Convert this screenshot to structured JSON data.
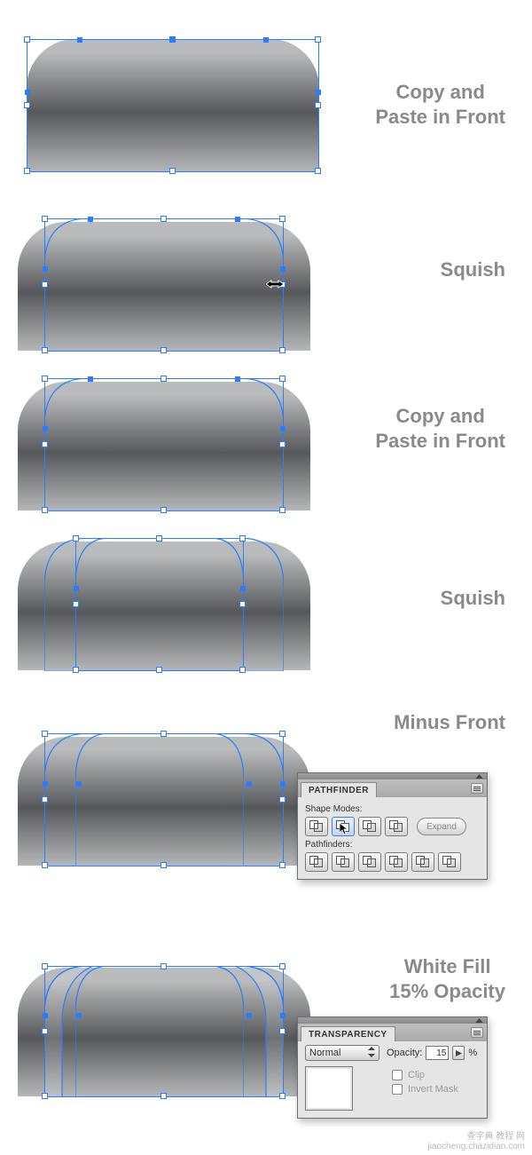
{
  "labels": {
    "step1": "Copy and\nPaste in Front",
    "step2": "Squish",
    "step3": "Copy and\nPaste in Front",
    "step4": "Squish",
    "step5": "Minus Front",
    "step6": "White Fill\n15% Opacity"
  },
  "pathfinder": {
    "panel_title": "PATHFINDER",
    "section_modes": "Shape Modes:",
    "section_paths": "Pathfinders:",
    "expand_label": "Expand",
    "mode_icons": [
      "unite-icon",
      "minus-front-icon",
      "intersect-icon",
      "exclude-icon"
    ],
    "path_icons": [
      "divide-icon",
      "trim-icon",
      "merge-icon",
      "crop-icon",
      "outline-icon",
      "minus-back-icon"
    ]
  },
  "transparency": {
    "panel_title": "TRANSPARENCY",
    "blend_mode": "Normal",
    "opacity_label": "Opacity:",
    "opacity_value": "15",
    "opacity_unit": "%",
    "clip_label": "Clip",
    "invert_label": "Invert Mask"
  },
  "watermark": {
    "line1": "查字典 教程 网",
    "line2": "jiaocheng.chazidian.com"
  },
  "colors": {
    "selection_blue": "#2b7dff",
    "label_gray": "#8a8a8a"
  }
}
